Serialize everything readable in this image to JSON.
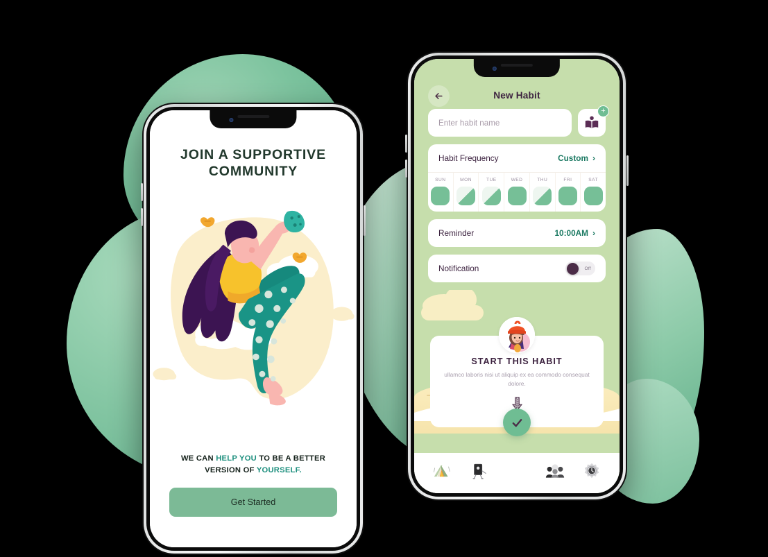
{
  "brand": {
    "green_primary": "#7cba96",
    "green_chip": "#76bf97",
    "screen_green": "#c6deac",
    "teal_accent": "#1d8f7e",
    "plum": "#3d2340",
    "cream": "#f8eec4"
  },
  "onboarding": {
    "title_line1": "JOIN A SUPPORTIVE",
    "title_line2": "COMMUNITY",
    "subtitle": {
      "part1": "WE CAN ",
      "highlight1": "HELP YOU",
      "part2": " TO BE A BETTER VERSION OF ",
      "highlight2": "YOURSELF."
    },
    "cta_label": "Get Started",
    "illustration_name": "woman-jumping-in-clouds-illustration"
  },
  "new_habit": {
    "back_icon": "arrow-left-icon",
    "title": "New Habit",
    "habit_name": {
      "value": "",
      "placeholder": "Enter habit name"
    },
    "icon_picker": {
      "icon": "open-book-icon",
      "badge": "+"
    },
    "frequency": {
      "label": "Habit Frequency",
      "value": "Custom",
      "chevron": "›",
      "days": [
        {
          "label": "SUN",
          "state": "full"
        },
        {
          "label": "MON",
          "state": "half"
        },
        {
          "label": "TUE",
          "state": "half"
        },
        {
          "label": "WED",
          "state": "full"
        },
        {
          "label": "THU",
          "state": "half"
        },
        {
          "label": "FRI",
          "state": "full"
        },
        {
          "label": "SAT",
          "state": "full"
        }
      ]
    },
    "reminder": {
      "label": "Reminder",
      "value": "10:00AM",
      "chevron": "›"
    },
    "notification": {
      "label": "Notification",
      "toggle_state": "Off"
    },
    "promo": {
      "title": "START THIS HABIT",
      "body": "ullamco laboris nisi ut aliquip ex ea commodo consequat dolore.",
      "avatar_name": "girl-with-red-beanie-avatar",
      "arrow_icon": "download-arrow-icon"
    },
    "confirm_button": {
      "icon": "check-icon"
    },
    "tabs": [
      {
        "name": "tent-icon"
      },
      {
        "name": "easel-board-icon"
      },
      {
        "name": "people-group-icon"
      },
      {
        "name": "clock-gear-icon"
      }
    ]
  }
}
